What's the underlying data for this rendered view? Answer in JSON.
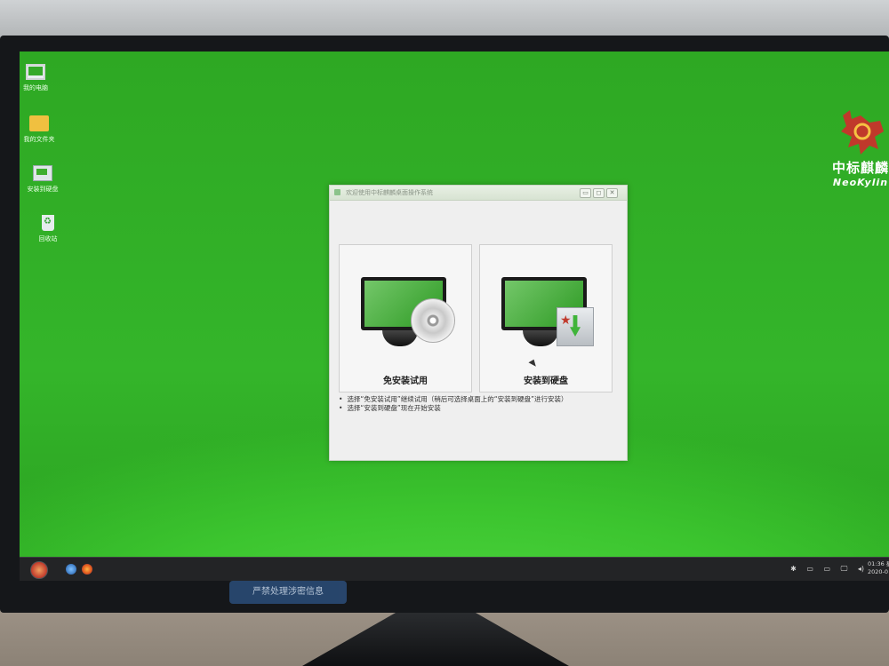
{
  "desktop": {
    "icons": [
      {
        "label": "我的电脑",
        "icon": "computer-icon"
      },
      {
        "label": "我的文件夹",
        "icon": "user-folder-icon"
      },
      {
        "label": "安装到硬盘",
        "icon": "install-icon"
      },
      {
        "label": "回收站",
        "icon": "trash-icon"
      }
    ],
    "brand": {
      "cn": "中标麒麟",
      "en": "NeoKylin"
    },
    "bezel_badge": "严禁处理涉密信息"
  },
  "dialog": {
    "title": "欢迎使用中标麒麟桌面操作系统",
    "buttons": {
      "minimize": "▭",
      "maximize": "◻",
      "close": "✕"
    },
    "options": [
      {
        "label": "免安装试用",
        "icon": "cd-monitor-icon"
      },
      {
        "label": "安装到硬盘",
        "icon": "install-disk-icon"
      }
    ],
    "notes": [
      "选择“免安装试用”继续试用（稍后可选择桌面上的“安装到硬盘”进行安装）",
      "选择“安装到硬盘”现在开始安装"
    ]
  },
  "taskbar": {
    "tray": [
      "✱",
      "▭",
      "▭",
      "🖵",
      "◂)"
    ],
    "time": "01:36 星",
    "date": "2020-0"
  }
}
